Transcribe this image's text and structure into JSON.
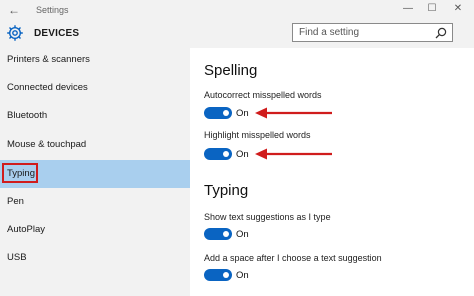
{
  "window": {
    "title": "Settings",
    "back_glyph": "←",
    "minimize_glyph": "—",
    "maximize_glyph": "☐",
    "close_glyph": "✕"
  },
  "header": {
    "icon": "gear-icon",
    "title": "DEVICES",
    "search_placeholder": "Find a setting",
    "search_icon": "search-icon"
  },
  "sidebar": {
    "items": [
      {
        "label": "Printers & scanners"
      },
      {
        "label": "Connected devices"
      },
      {
        "label": "Bluetooth"
      },
      {
        "label": "Mouse & touchpad"
      },
      {
        "label": "Typing",
        "selected": true
      },
      {
        "label": "Pen"
      },
      {
        "label": "AutoPlay"
      },
      {
        "label": "USB"
      }
    ]
  },
  "main": {
    "spelling": {
      "title": "Spelling",
      "autocorrect": {
        "label": "Autocorrect misspelled words",
        "state": "On"
      },
      "highlight": {
        "label": "Highlight misspelled words",
        "state": "On"
      }
    },
    "typing": {
      "title": "Typing",
      "suggestions": {
        "label": "Show text suggestions as I type",
        "state": "On"
      },
      "add_space": {
        "label": "Add a space after I choose a text suggestion",
        "state": "On"
      }
    }
  },
  "colors": {
    "accent": "#0a64c2",
    "selected_bg": "#a9cfee",
    "annotation_red": "#d01c1c",
    "chrome_bg": "#f2f2f2"
  }
}
